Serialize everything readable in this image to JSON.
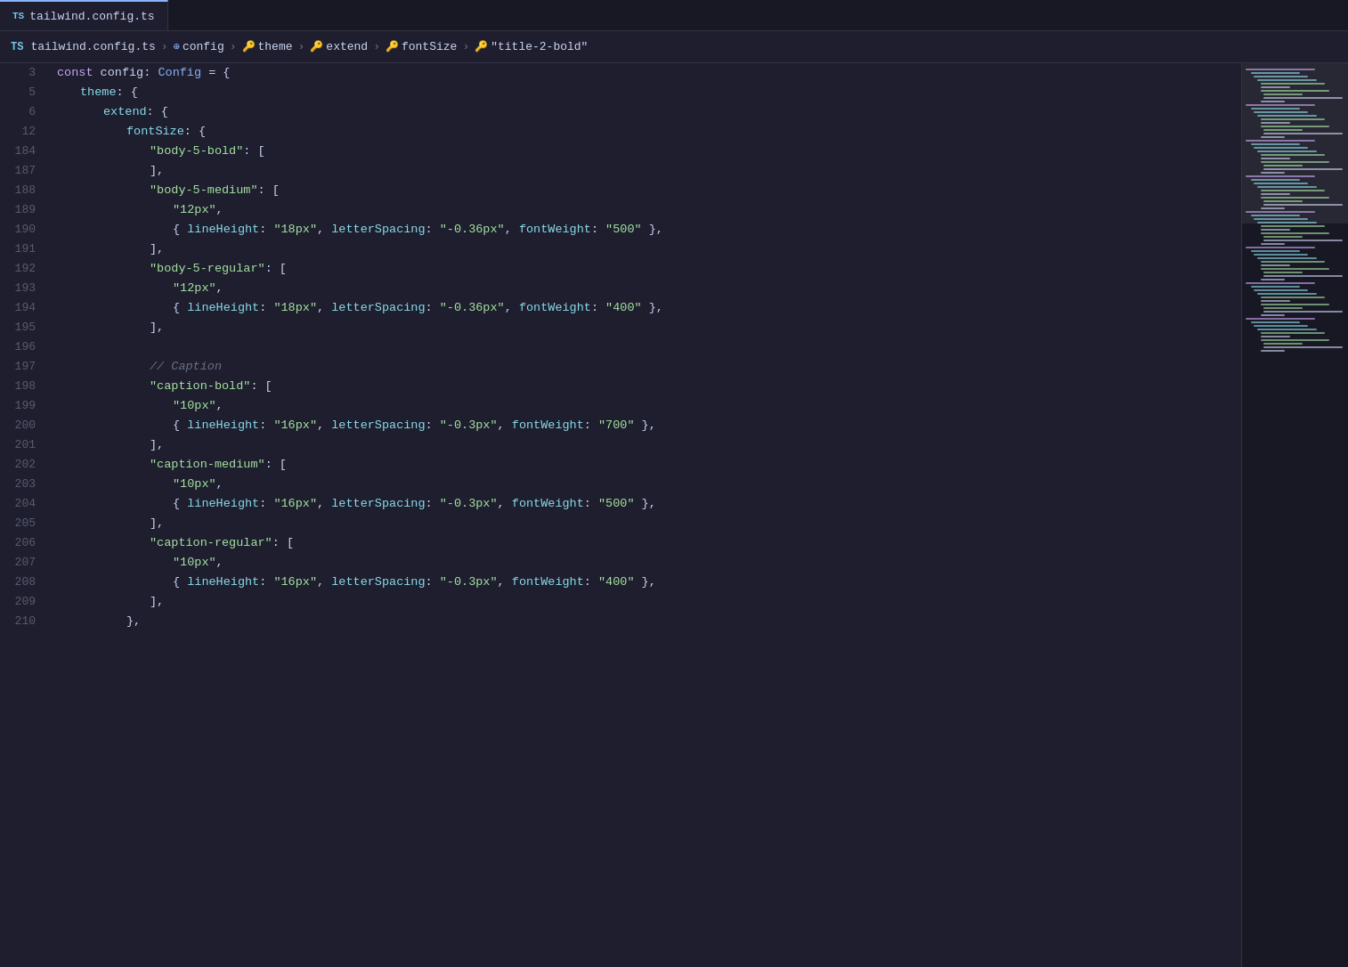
{
  "breadcrumb": {
    "lang": "TS",
    "file": "tailwind.config.ts",
    "segments": [
      {
        "label": "config",
        "icon": "symbol-icon"
      },
      {
        "label": "theme",
        "icon": "key-icon"
      },
      {
        "label": "extend",
        "icon": "key-icon"
      },
      {
        "label": "fontSize",
        "icon": "key-icon"
      },
      {
        "label": "\"title-2-bold\"",
        "icon": "key-icon"
      }
    ]
  },
  "lines": [
    {
      "num": "3",
      "tokens": [
        {
          "t": "kw",
          "v": "const"
        },
        {
          "t": "punct",
          "v": " config"
        },
        {
          "t": "punct",
          "v": ": "
        },
        {
          "t": "type",
          "v": "Config"
        },
        {
          "t": "punct",
          "v": " = {"
        }
      ]
    },
    {
      "num": "5",
      "indent": 1,
      "tokens": [
        {
          "t": "prop",
          "v": "theme"
        },
        {
          "t": "punct",
          "v": ": {"
        }
      ]
    },
    {
      "num": "6",
      "indent": 2,
      "tokens": [
        {
          "t": "prop",
          "v": "extend"
        },
        {
          "t": "punct",
          "v": ": {"
        }
      ]
    },
    {
      "num": "12",
      "indent": 3,
      "tokens": [
        {
          "t": "prop",
          "v": "fontSize"
        },
        {
          "t": "punct",
          "v": ": {"
        }
      ]
    },
    {
      "num": "184",
      "indent": 4,
      "tokens": [
        {
          "t": "str",
          "v": "\"body-5-bold\""
        },
        {
          "t": "punct",
          "v": ": ["
        }
      ]
    },
    {
      "num": "187",
      "indent": 4,
      "tokens": [
        {
          "t": "punct",
          "v": "],"
        }
      ]
    },
    {
      "num": "188",
      "indent": 4,
      "tokens": [
        {
          "t": "str",
          "v": "\"body-5-medium\""
        },
        {
          "t": "punct",
          "v": ": ["
        }
      ]
    },
    {
      "num": "189",
      "indent": 5,
      "tokens": [
        {
          "t": "str",
          "v": "\"12px\""
        },
        {
          "t": "punct",
          "v": ","
        }
      ]
    },
    {
      "num": "190",
      "indent": 5,
      "tokens": [
        {
          "t": "punct",
          "v": "{ "
        },
        {
          "t": "prop",
          "v": "lineHeight"
        },
        {
          "t": "punct",
          "v": ": "
        },
        {
          "t": "str",
          "v": "\"18px\""
        },
        {
          "t": "punct",
          "v": ", "
        },
        {
          "t": "prop",
          "v": "letterSpacing"
        },
        {
          "t": "punct",
          "v": ": "
        },
        {
          "t": "str",
          "v": "\"-0.36px\""
        },
        {
          "t": "punct",
          "v": ", "
        },
        {
          "t": "prop",
          "v": "fontWeight"
        },
        {
          "t": "punct",
          "v": ": "
        },
        {
          "t": "str",
          "v": "\"500\""
        },
        {
          "t": "punct",
          "v": " },"
        }
      ]
    },
    {
      "num": "191",
      "indent": 4,
      "tokens": [
        {
          "t": "punct",
          "v": "],"
        }
      ]
    },
    {
      "num": "192",
      "indent": 4,
      "tokens": [
        {
          "t": "str",
          "v": "\"body-5-regular\""
        },
        {
          "t": "punct",
          "v": ": ["
        }
      ]
    },
    {
      "num": "193",
      "indent": 5,
      "tokens": [
        {
          "t": "str",
          "v": "\"12px\""
        },
        {
          "t": "punct",
          "v": ","
        }
      ]
    },
    {
      "num": "194",
      "indent": 5,
      "tokens": [
        {
          "t": "punct",
          "v": "{ "
        },
        {
          "t": "prop",
          "v": "lineHeight"
        },
        {
          "t": "punct",
          "v": ": "
        },
        {
          "t": "str",
          "v": "\"18px\""
        },
        {
          "t": "punct",
          "v": ", "
        },
        {
          "t": "prop",
          "v": "letterSpacing"
        },
        {
          "t": "punct",
          "v": ": "
        },
        {
          "t": "str",
          "v": "\"-0.36px\""
        },
        {
          "t": "punct",
          "v": ", "
        },
        {
          "t": "prop",
          "v": "fontWeight"
        },
        {
          "t": "punct",
          "v": ": "
        },
        {
          "t": "str",
          "v": "\"400\""
        },
        {
          "t": "punct",
          "v": " },"
        }
      ]
    },
    {
      "num": "195",
      "indent": 4,
      "tokens": [
        {
          "t": "punct",
          "v": "],"
        }
      ]
    },
    {
      "num": "196",
      "tokens": []
    },
    {
      "num": "197",
      "indent": 4,
      "tokens": [
        {
          "t": "comment",
          "v": "// Caption"
        }
      ]
    },
    {
      "num": "198",
      "indent": 4,
      "tokens": [
        {
          "t": "str",
          "v": "\"caption-bold\""
        },
        {
          "t": "punct",
          "v": ": ["
        }
      ]
    },
    {
      "num": "199",
      "indent": 5,
      "tokens": [
        {
          "t": "str",
          "v": "\"10px\""
        },
        {
          "t": "punct",
          "v": ","
        }
      ]
    },
    {
      "num": "200",
      "indent": 5,
      "tokens": [
        {
          "t": "punct",
          "v": "{ "
        },
        {
          "t": "prop",
          "v": "lineHeight"
        },
        {
          "t": "punct",
          "v": ": "
        },
        {
          "t": "str",
          "v": "\"16px\""
        },
        {
          "t": "punct",
          "v": ", "
        },
        {
          "t": "prop",
          "v": "letterSpacing"
        },
        {
          "t": "punct",
          "v": ": "
        },
        {
          "t": "str",
          "v": "\"-0.3px\""
        },
        {
          "t": "punct",
          "v": ", "
        },
        {
          "t": "prop",
          "v": "fontWeight"
        },
        {
          "t": "punct",
          "v": ": "
        },
        {
          "t": "str",
          "v": "\"700\""
        },
        {
          "t": "punct",
          "v": " },"
        }
      ]
    },
    {
      "num": "201",
      "indent": 4,
      "tokens": [
        {
          "t": "punct",
          "v": "],"
        }
      ]
    },
    {
      "num": "202",
      "indent": 4,
      "tokens": [
        {
          "t": "str",
          "v": "\"caption-medium\""
        },
        {
          "t": "punct",
          "v": ": ["
        }
      ]
    },
    {
      "num": "203",
      "indent": 5,
      "tokens": [
        {
          "t": "str",
          "v": "\"10px\""
        },
        {
          "t": "punct",
          "v": ","
        }
      ]
    },
    {
      "num": "204",
      "indent": 5,
      "tokens": [
        {
          "t": "punct",
          "v": "{ "
        },
        {
          "t": "prop",
          "v": "lineHeight"
        },
        {
          "t": "punct",
          "v": ": "
        },
        {
          "t": "str",
          "v": "\"16px\""
        },
        {
          "t": "punct",
          "v": ", "
        },
        {
          "t": "prop",
          "v": "letterSpacing"
        },
        {
          "t": "punct",
          "v": ": "
        },
        {
          "t": "str",
          "v": "\"-0.3px\""
        },
        {
          "t": "punct",
          "v": ", "
        },
        {
          "t": "prop",
          "v": "fontWeight"
        },
        {
          "t": "punct",
          "v": ": "
        },
        {
          "t": "str",
          "v": "\"500\""
        },
        {
          "t": "punct",
          "v": " },"
        }
      ]
    },
    {
      "num": "205",
      "indent": 4,
      "tokens": [
        {
          "t": "punct",
          "v": "],"
        }
      ]
    },
    {
      "num": "206",
      "indent": 4,
      "tokens": [
        {
          "t": "str",
          "v": "\"caption-regular\""
        },
        {
          "t": "punct",
          "v": ": ["
        }
      ]
    },
    {
      "num": "207",
      "indent": 5,
      "tokens": [
        {
          "t": "str",
          "v": "\"10px\""
        },
        {
          "t": "punct",
          "v": ","
        }
      ]
    },
    {
      "num": "208",
      "indent": 5,
      "tokens": [
        {
          "t": "punct",
          "v": "{ "
        },
        {
          "t": "prop",
          "v": "lineHeight"
        },
        {
          "t": "punct",
          "v": ": "
        },
        {
          "t": "str",
          "v": "\"16px\""
        },
        {
          "t": "punct",
          "v": ", "
        },
        {
          "t": "prop",
          "v": "letterSpacing"
        },
        {
          "t": "punct",
          "v": ": "
        },
        {
          "t": "str",
          "v": "\"-0.3px\""
        },
        {
          "t": "punct",
          "v": ", "
        },
        {
          "t": "prop",
          "v": "fontWeight"
        },
        {
          "t": "punct",
          "v": ": "
        },
        {
          "t": "str",
          "v": "\"400\""
        },
        {
          "t": "punct",
          "v": " },"
        }
      ]
    },
    {
      "num": "209",
      "indent": 4,
      "tokens": [
        {
          "t": "punct",
          "v": "],"
        }
      ]
    },
    {
      "num": "210",
      "indent": 3,
      "tokens": [
        {
          "t": "punct",
          "v": "},"
        }
      ]
    }
  ],
  "tab": {
    "lang": "TS",
    "filename": "tailwind.config.ts"
  },
  "colors": {
    "bg": "#1e1e2e",
    "sidebar_bg": "#181825",
    "accent": "#89b4fa",
    "string": "#a6e3a1",
    "keyword": "#cba6f7",
    "comment": "#6c7086",
    "property": "#89dceb"
  }
}
